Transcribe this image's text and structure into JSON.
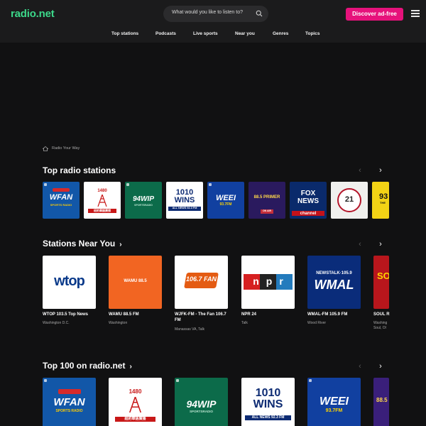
{
  "header": {
    "logo": "radio.net",
    "search_placeholder": "What would you like to listen to?",
    "cta_label": "Discover ad-free",
    "nav": [
      "Top stations",
      "Podcasts",
      "Live sports",
      "Near you",
      "Genres",
      "Topics"
    ]
  },
  "breadcrumb": {
    "label": "Radio Your Way"
  },
  "sections": {
    "top_stations": {
      "title": "Top radio stations",
      "tiles": [
        {
          "icon": "wfan-logo",
          "text": "WFAN",
          "sub": "SPORTS RADIO"
        },
        {
          "icon": "radio-1480-logo",
          "text": "1480",
          "sub": "紐約華語廣播"
        },
        {
          "icon": "94wip-logo",
          "text": "94WIP",
          "sub": "SPORTSRADIO"
        },
        {
          "icon": "1010wins-logo",
          "text": "1010 WINS",
          "sub": "ALL NEWS 92.3 FM"
        },
        {
          "icon": "weei-logo",
          "text": "WEEI",
          "sub": "93.7FM"
        },
        {
          "icon": "the-primer-logo",
          "text": "88.5 PRIMER",
          "sub": "ON AIR"
        },
        {
          "icon": "fox-news-logo",
          "text": "FOX NEWS",
          "sub": "channel"
        },
        {
          "icon": "morning-show-logo",
          "text": "21",
          "sub": ""
        },
        {
          "icon": "partial-logo",
          "text": "93",
          "sub": "THE"
        }
      ]
    },
    "near_you": {
      "title": "Stations Near You",
      "stations": [
        {
          "icon": "wtop-logo",
          "logo_text": "wtop",
          "name": "WTOP 103.5 Top News",
          "location": "Washington D.C."
        },
        {
          "icon": "wamu-logo",
          "logo_text": "WAMU 88.5",
          "name": "WAMU 88.5 FM",
          "location": "Washington"
        },
        {
          "icon": "the-fan-logo",
          "logo_text": "106.7 FAN",
          "name": "WJFK-FM - The Fan 106.7 FM",
          "location": "Manassas VA, Talk"
        },
        {
          "icon": "npr-logo",
          "logo_text": "npr",
          "name": "NPR 24",
          "location": "Talk"
        },
        {
          "icon": "wmal-logo",
          "logo_text": "WMAL",
          "name": "WMAL-FM 105.9 FM",
          "location": "Wood River"
        },
        {
          "icon": "soul-radio-logo",
          "logo_text": "SOUL",
          "name": "SOUL R",
          "location": "Washing Soul, Ol"
        }
      ]
    },
    "top100": {
      "title": "Top 100 on radio.net",
      "tiles": [
        {
          "icon": "wfan-logo",
          "text": "WFAN",
          "sub": "SPORTS RADIO"
        },
        {
          "icon": "radio-1480-logo",
          "text": "1480",
          "sub": "紐約華語廣播"
        },
        {
          "icon": "94wip-logo",
          "text": "94WIP",
          "sub": "SPORTSRADIO"
        },
        {
          "icon": "1010wins-logo",
          "text": "1010 WINS",
          "sub": "ALL NEWS 92.3 FM"
        },
        {
          "icon": "weei-logo",
          "text": "WEEI",
          "sub": "93.7FM"
        },
        {
          "icon": "partial-logo",
          "text": "88.5",
          "sub": ""
        }
      ]
    }
  },
  "colors": {
    "accent": "#3cd88a",
    "cta": "#e6127b",
    "background": "#111112",
    "header": "#1b1b1c"
  }
}
